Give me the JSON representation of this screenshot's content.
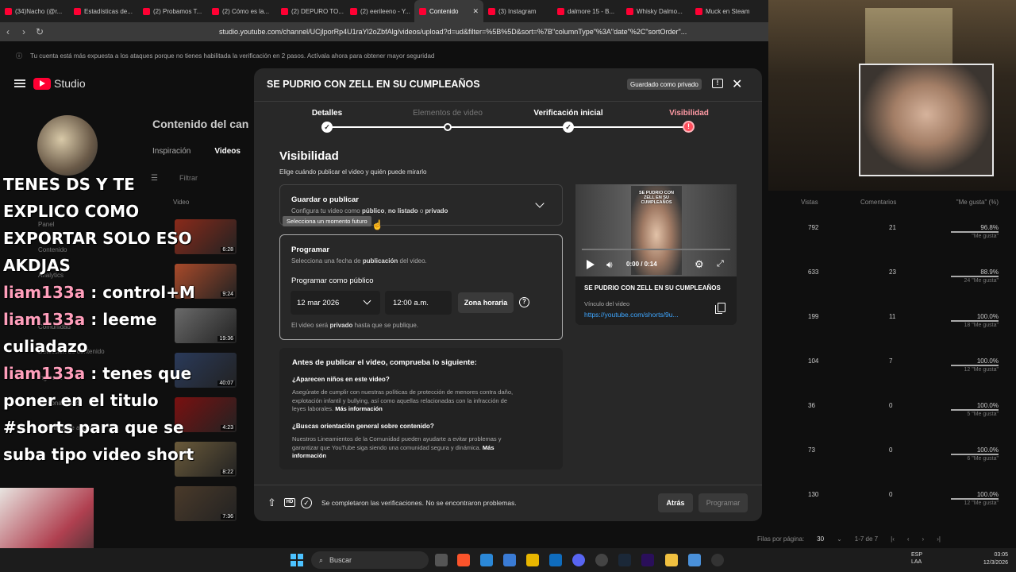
{
  "browser": {
    "tabs": [
      {
        "label": "(34)Nacho (@r..."
      },
      {
        "label": "Estadísticas de..."
      },
      {
        "label": "(2) Probamos T..."
      },
      {
        "label": "(2) Cómo es la..."
      },
      {
        "label": "(2) DEPURO TO..."
      },
      {
        "label": "(2) eerileeno - Y..."
      },
      {
        "label": "Contenido",
        "active": true
      },
      {
        "label": "(3) Instagram"
      },
      {
        "label": "dalmore 15 - B..."
      },
      {
        "label": "Whisky Dalmo..."
      },
      {
        "label": "Muck en Steam"
      }
    ],
    "url": "studio.youtube.com/channel/UCjlporRp4U1raYl2oZbfAlg/videos/upload?d=ud&filter=%5B%5D&sort=%7B\"columnType\"%3A\"date\"%2C\"sortOrder\"...",
    "security_notice": "Tu cuenta está más expuesta a los ataques porque no tienes habilitada la verificación en 2 pasos. Actívala ahora para obtener mayor seguridad"
  },
  "studio": {
    "logo_text": "Studio",
    "channel_title": "Contenido del can",
    "tabs": [
      "Inspiración",
      "Videos"
    ],
    "filter_label": "Filtrar",
    "column_video": "Video",
    "side_labels": [
      "Panel",
      "Contenido",
      "Analytics",
      "Comunidad",
      "Detección de contenido",
      "Ingresos",
      "Personalización",
      "Biblioteca de audio"
    ],
    "durations": [
      "6:28",
      "9:24",
      "19:36",
      "40:07",
      "4:23",
      "8:22",
      "7:36"
    ],
    "table_headers": {
      "views": "Vistas",
      "comments": "Comentarios",
      "likes": "\"Me gusta\" (%)"
    },
    "rows": [
      {
        "views": "792",
        "comments": "21",
        "likes": "96.8%",
        "likes_sub": "\"Me gusta\""
      },
      {
        "views": "633",
        "comments": "23",
        "likes": "88.9%",
        "likes_sub": "24 \"Me gusta\""
      },
      {
        "views": "199",
        "comments": "11",
        "likes": "100.0%",
        "likes_sub": "18 \"Me gusta\""
      },
      {
        "views": "104",
        "comments": "7",
        "likes": "100.0%",
        "likes_sub": "12 \"Me gusta\""
      },
      {
        "views": "36",
        "comments": "0",
        "likes": "100.0%",
        "likes_sub": "5 \"Me gusta\""
      },
      {
        "views": "73",
        "comments": "0",
        "likes": "100.0%",
        "likes_sub": "6 \"Me gusta\""
      },
      {
        "views": "130",
        "comments": "0",
        "likes": "100.0%",
        "likes_sub": "12 \"Me gusta\""
      }
    ],
    "pagination": {
      "label": "Filas por página:",
      "value": "30",
      "range": "1-7 de 7"
    }
  },
  "chat": {
    "lines": [
      {
        "user": "",
        "text": "TENES DS Y TE EXPLICO COMO EXPORTAR SOLO ESO AKDJAS"
      },
      {
        "user": "liam133a",
        "text": " : control+M"
      },
      {
        "user": "liam133a",
        "text": " : leeme culiadazo"
      },
      {
        "user": "liam133a",
        "text": " : tenes que poner en el titulo #shorts para que se suba tipo video short"
      }
    ]
  },
  "dialog": {
    "title": "SE PUDRIO CON ZELL EN SU CUMPLEAÑOS",
    "saved_badge": "Guardado como privado",
    "steps": [
      "Detalles",
      "Elementos de video",
      "Verificación inicial",
      "Visibilidad"
    ],
    "visibility_title": "Visibilidad",
    "visibility_sub": "Elige cuándo publicar el video y quién puede mirarlo",
    "save_title": "Guardar o publicar",
    "save_sub_prefix": "Configura tu video como ",
    "save_sub_public": "público",
    "save_sub_sep1": ", ",
    "save_sub_unlisted": "no listado",
    "save_sub_sep2": " o ",
    "save_sub_private": "privado",
    "tooltip": "Selecciona un momento futuro",
    "schedule_title": "Programar",
    "schedule_sub_prefix": "Selecciona una fecha de ",
    "schedule_sub_bold": "publicación",
    "schedule_sub_suffix": " del video.",
    "schedule_label": "Programar como público",
    "date_value": "12 mar 2026",
    "time_value": "12:00 a.m.",
    "timezone_button": "Zona horaria",
    "note_prefix": "El video será ",
    "note_bold": "privado",
    "note_suffix": " hasta que se publique.",
    "checklist_title": "Antes de publicar el video, comprueba lo siguiente:",
    "q1": "¿Aparecen niños en este video?",
    "t1": "Asegúrate de cumplir con nuestras políticas de protección de menores contra daño, explotación infantil y bullying, así como aquellas relacionadas con la infracción de leyes laborales.",
    "t1_link": "Más información",
    "q2": "¿Buscas orientación general sobre contenido?",
    "t2": "Nuestros Lineamientos de la Comunidad pueden ayudarte a evitar problemas y garantizar que YouTube siga siendo una comunidad segura y dinámica.",
    "t2_link": "Más información",
    "video_caption": "SE PUDRIO CON ZELL EN SU CUMPLEAÑOS",
    "video_time": "0:00 / 0:14",
    "video_title": "SE PUDRIO CON ZELL EN SU CUMPLEAÑOS",
    "link_label": "Vínculo del video",
    "link_url": "https://youtube.com/shorts/9u...",
    "footer_msg": "Se completaron las verificaciones. No se encontraron problemas.",
    "back_button": "Atrás",
    "schedule_button": "Programar"
  },
  "taskbar": {
    "search": "Buscar",
    "lang": "ESP",
    "lang2": "LAA",
    "time": "03:05",
    "date": "12/3/2026"
  }
}
